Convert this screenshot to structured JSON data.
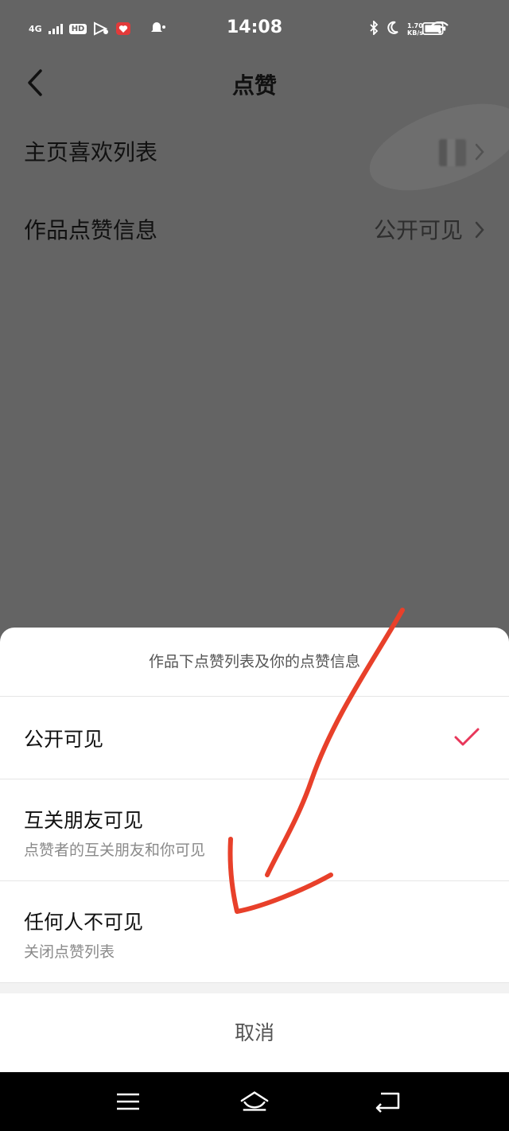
{
  "status_bar": {
    "network": "4G",
    "hd": "HD",
    "time": "14:08",
    "speed_value": "1.70",
    "speed_unit": "KB/s"
  },
  "header": {
    "title": "点赞"
  },
  "settings": [
    {
      "label": "主页喜欢列表",
      "value": ""
    },
    {
      "label": "作品点赞信息",
      "value": "公开可见"
    }
  ],
  "sheet": {
    "title": "作品下点赞列表及你的点赞信息",
    "options": [
      {
        "title": "公开可见",
        "subtitle": "",
        "selected": true
      },
      {
        "title": "互关朋友可见",
        "subtitle": "点赞者的互关朋友和你可见",
        "selected": false
      },
      {
        "title": "任何人不可见",
        "subtitle": "关闭点赞列表",
        "selected": false
      }
    ],
    "cancel_label": "取消"
  },
  "colors": {
    "accent_check": "#e8375a",
    "annotation": "#e8402a",
    "overlay": "#646464"
  },
  "icons": [
    "back-arrow-icon",
    "chevron-right-icon",
    "checkmark-icon",
    "menu-icon",
    "home-icon",
    "back-nav-icon"
  ]
}
